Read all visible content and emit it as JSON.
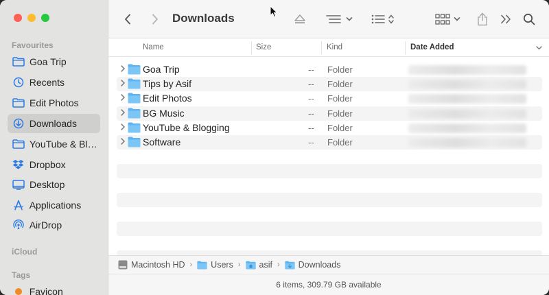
{
  "window": {
    "title": "Downloads",
    "traffic_colors": [
      "#fe5f57",
      "#febc2e",
      "#28c840"
    ]
  },
  "sidebar": {
    "favourites_heading": "Favourites",
    "items": [
      {
        "label": "Goa Trip",
        "icon": "folder-icon"
      },
      {
        "label": "Recents",
        "icon": "clock-icon"
      },
      {
        "label": "Edit Photos",
        "icon": "folder-icon"
      },
      {
        "label": "Downloads",
        "icon": "download-icon",
        "selected": true
      },
      {
        "label": "YouTube & Blogging",
        "icon": "folder-icon"
      },
      {
        "label": "Dropbox",
        "icon": "dropbox-icon"
      },
      {
        "label": "Desktop",
        "icon": "desktop-icon"
      },
      {
        "label": "Applications",
        "icon": "applications-icon"
      },
      {
        "label": "AirDrop",
        "icon": "airdrop-icon"
      }
    ],
    "icloud_heading": "iCloud",
    "tags_heading": "Tags",
    "tag_items": [
      {
        "label": "Favicon",
        "color": "#f08a24"
      }
    ],
    "accent_color": "#2a7ae4"
  },
  "columns": {
    "name": "Name",
    "size": "Size",
    "kind": "Kind",
    "date_added": "Date Added"
  },
  "files": [
    {
      "name": "Goa Trip",
      "size": "--",
      "kind": "Folder"
    },
    {
      "name": "Tips by Asif",
      "size": "--",
      "kind": "Folder"
    },
    {
      "name": "Edit Photos",
      "size": "--",
      "kind": "Folder"
    },
    {
      "name": "BG Music",
      "size": "--",
      "kind": "Folder"
    },
    {
      "name": "YouTube & Blogging",
      "size": "--",
      "kind": "Folder"
    },
    {
      "name": "Software",
      "size": "--",
      "kind": "Folder"
    }
  ],
  "pathbar": {
    "segments": [
      "Macintosh HD",
      "Users",
      "asif",
      "Downloads"
    ]
  },
  "status": {
    "text": "6 items, 309.79 GB available"
  }
}
